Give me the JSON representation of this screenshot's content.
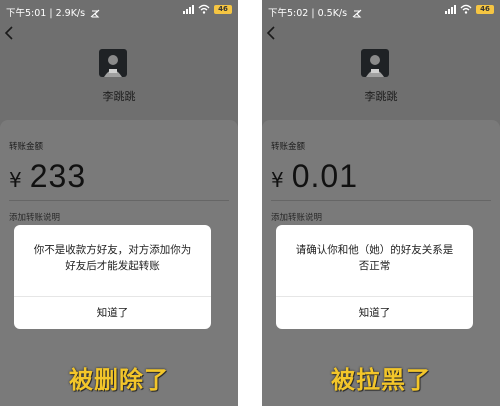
{
  "left_screen": {
    "status": {
      "time": "下午5:01",
      "speed": "2.9K/s",
      "battery": "46"
    },
    "user_name": "李跳跳",
    "amount_label": "转账金额",
    "currency": "¥",
    "amount": "233",
    "remark_link": "添加转账说明",
    "dialog": {
      "message": "你不是收款方好友，对方添加你为好友后才能发起转账",
      "button": "知道了"
    },
    "caption": "被删除了"
  },
  "right_screen": {
    "status": {
      "time": "下午5:02",
      "speed": "0.5K/s",
      "battery": "46"
    },
    "user_name": "李跳跳",
    "amount_label": "转账金额",
    "currency": "¥",
    "amount": "0.01",
    "remark_link": "添加转账说明",
    "dialog": {
      "message": "请确认你和他（她）的好友关系是否正常",
      "button": "知道了"
    },
    "caption": "被拉黑了"
  },
  "colors": {
    "overlay_bg": "#6f6f6f",
    "card_bg": "#7a7a7a",
    "caption": "#f3c62a",
    "battery": "#f5c542"
  },
  "icons": [
    "back-arrow-icon",
    "signal-icon",
    "wifi-icon",
    "battery-icon",
    "do-not-disturb-icon",
    "avatar"
  ]
}
